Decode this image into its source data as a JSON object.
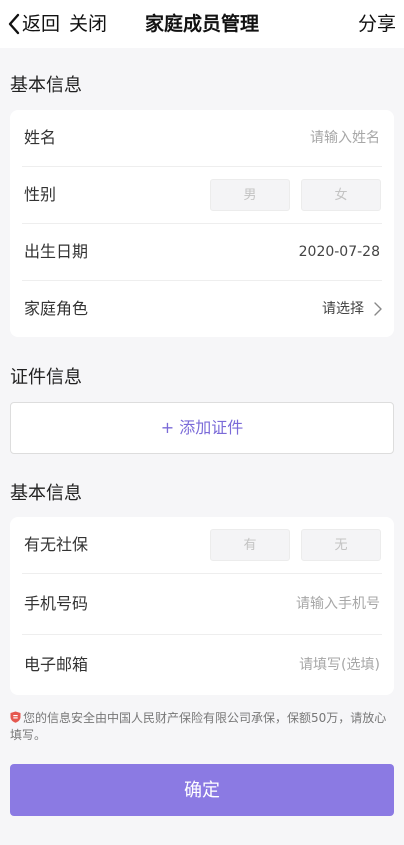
{
  "navbar": {
    "back_label": "返回",
    "close_label": "关闭",
    "title": "家庭成员管理",
    "share_label": "分享"
  },
  "basic_info": {
    "section_title": "基本信息",
    "name": {
      "label": "姓名",
      "placeholder": "请输入姓名",
      "value": ""
    },
    "gender": {
      "label": "性别",
      "options": [
        "男",
        "女"
      ]
    },
    "birth_date": {
      "label": "出生日期",
      "value": "2020-07-28"
    },
    "family_role": {
      "label": "家庭角色",
      "value": "请选择"
    }
  },
  "certificate_info": {
    "section_title": "证件信息",
    "add_label": "+ 添加证件"
  },
  "other_info": {
    "section_title": "基本信息",
    "social_security": {
      "label": "有无社保",
      "options": [
        "有",
        "无"
      ]
    },
    "phone": {
      "label": "手机号码",
      "placeholder": "请输入手机号",
      "value": ""
    },
    "email": {
      "label": "电子邮箱",
      "placeholder": "请填写(选填)",
      "value": ""
    }
  },
  "notice": {
    "text": "您的信息安全由中国人民财产保险有限公司承保，保额50万，请放心填写。"
  },
  "confirm_label": "确定",
  "colors": {
    "accent": "#8b7ae3",
    "accent_text": "#7b6bd8",
    "shield": "#e5584f"
  }
}
